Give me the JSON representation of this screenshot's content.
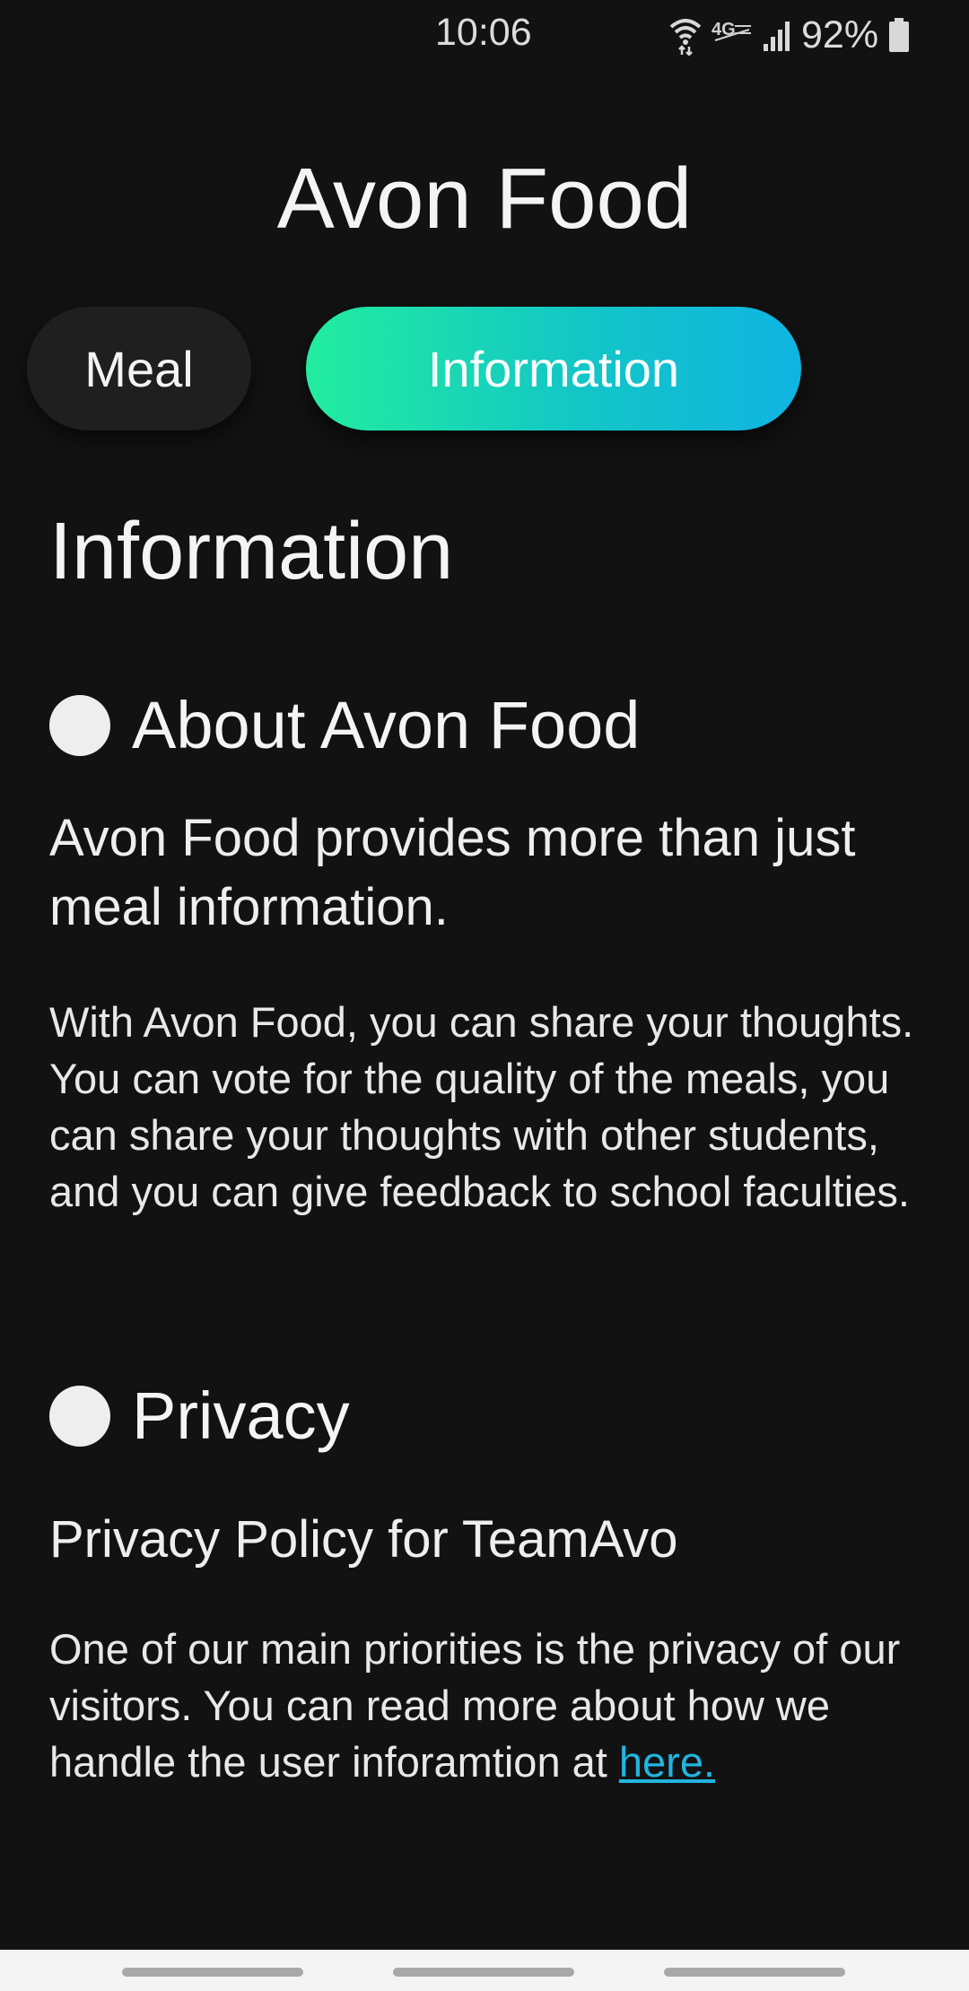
{
  "status_bar": {
    "time": "10:06",
    "battery": "92%",
    "icons": [
      "wifi-icon",
      "lte-icon",
      "signal-icon",
      "battery-icon"
    ]
  },
  "header": {
    "title": "Avon Food"
  },
  "tabs": [
    {
      "label": "Meal",
      "active": false
    },
    {
      "label": "Information",
      "active": true
    }
  ],
  "main": {
    "heading": "Information",
    "sections": [
      {
        "title": "About Avon Food",
        "lead": "Avon Food provides more than just meal information.",
        "body": "With Avon Food, you can share your thoughts. You can vote for the quality of the meals, you can share your thoughts with other students, and you can give feedback to school faculties."
      },
      {
        "title": "Privacy",
        "lead": "Privacy Policy for TeamAvo",
        "body": "One of our main priorities is the privacy of our visitors. You can read more about how we handle the user inforamtion at",
        "link_text": "here."
      }
    ]
  },
  "colors": {
    "background": "#121212",
    "tab_gradient_start": "#22ed9f",
    "tab_gradient_end": "#10b4e2",
    "link": "#22b5e0"
  }
}
